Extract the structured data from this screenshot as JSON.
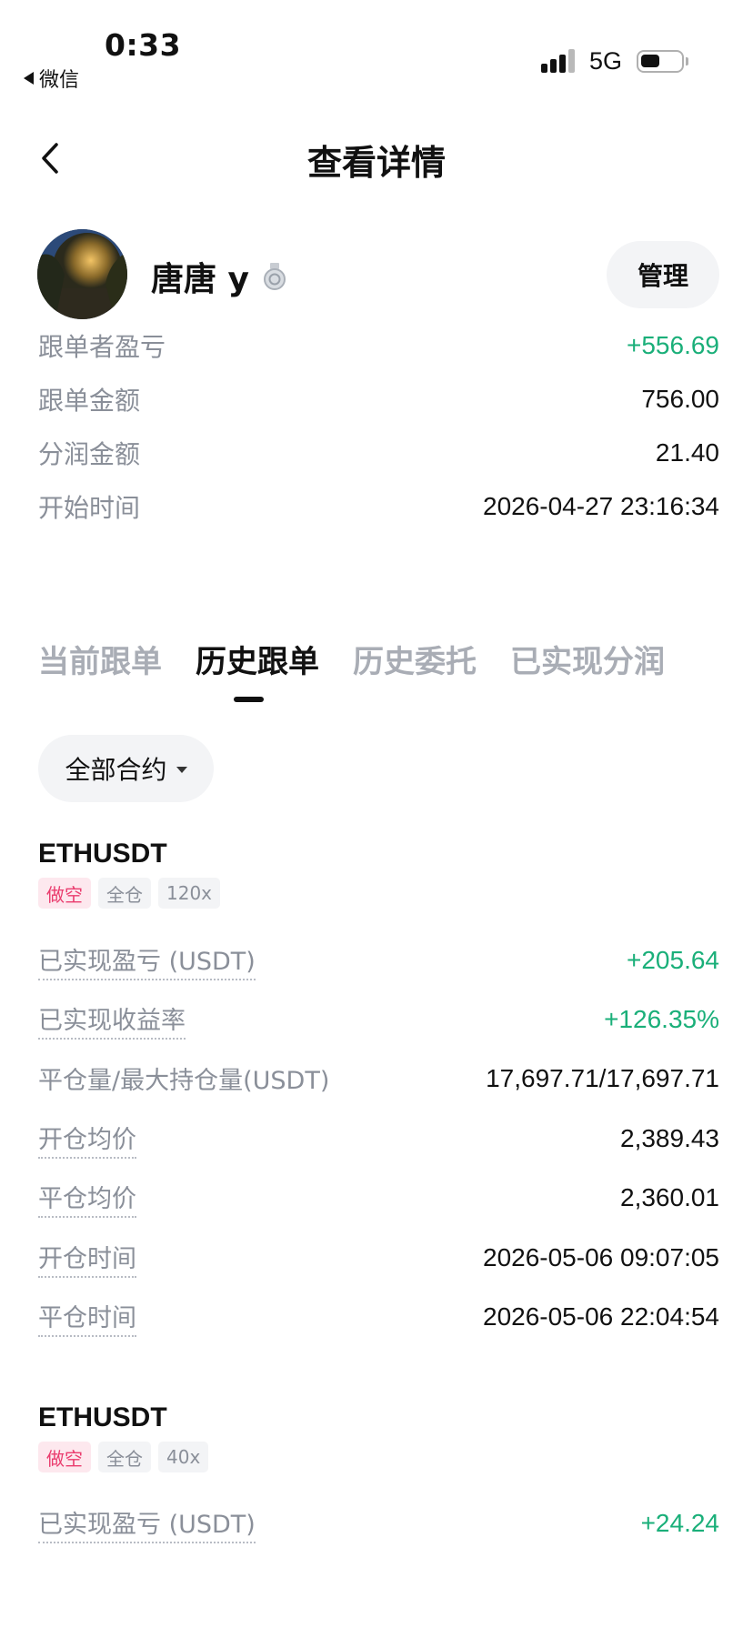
{
  "status_bar": {
    "time": "0:33",
    "back_app_label": "微信",
    "network": "5G"
  },
  "nav": {
    "title": "查看详情"
  },
  "profile": {
    "name": "唐唐 y",
    "manage_label": "管理"
  },
  "summary": [
    {
      "label": "跟单者盈亏",
      "value": "+556.69",
      "positive": true
    },
    {
      "label": "跟单金额",
      "value": "756.00",
      "positive": false
    },
    {
      "label": "分润金额",
      "value": "21.40",
      "positive": false
    },
    {
      "label": "开始时间",
      "value": "2026-04-27 23:16:34",
      "positive": false
    }
  ],
  "tabs": [
    {
      "label": "当前跟单",
      "active": false
    },
    {
      "label": "历史跟单",
      "active": true
    },
    {
      "label": "历史委托",
      "active": false
    },
    {
      "label": "已实现分润",
      "active": false
    }
  ],
  "filter": {
    "label": "全部合约"
  },
  "positions": [
    {
      "symbol": "ETHUSDT",
      "tags": [
        "做空",
        "全仓",
        "120x"
      ],
      "rows": [
        {
          "label": "已实现盈亏 (USDT)",
          "value": "+205.64",
          "positive": true
        },
        {
          "label": "已实现收益率",
          "value": "+126.35%",
          "positive": true
        },
        {
          "label": "平仓量/最大持仓量(USDT)",
          "value": "17,697.71/17,697.71",
          "positive": false
        },
        {
          "label": "开仓均价",
          "value": "2,389.43",
          "positive": false
        },
        {
          "label": "平仓均价",
          "value": "2,360.01",
          "positive": false
        },
        {
          "label": "开仓时间",
          "value": "2026-05-06 09:07:05",
          "positive": false
        },
        {
          "label": "平仓时间",
          "value": "2026-05-06 22:04:54",
          "positive": false
        }
      ]
    },
    {
      "symbol": "ETHUSDT",
      "tags": [
        "做空",
        "全仓",
        "40x"
      ],
      "rows": [
        {
          "label": "已实现盈亏 (USDT)",
          "value": "+24.24",
          "positive": true
        }
      ]
    }
  ],
  "colors": {
    "positive": "#1aaf79",
    "short_tag": "#ea3c6e",
    "muted": "#8a8f99"
  }
}
